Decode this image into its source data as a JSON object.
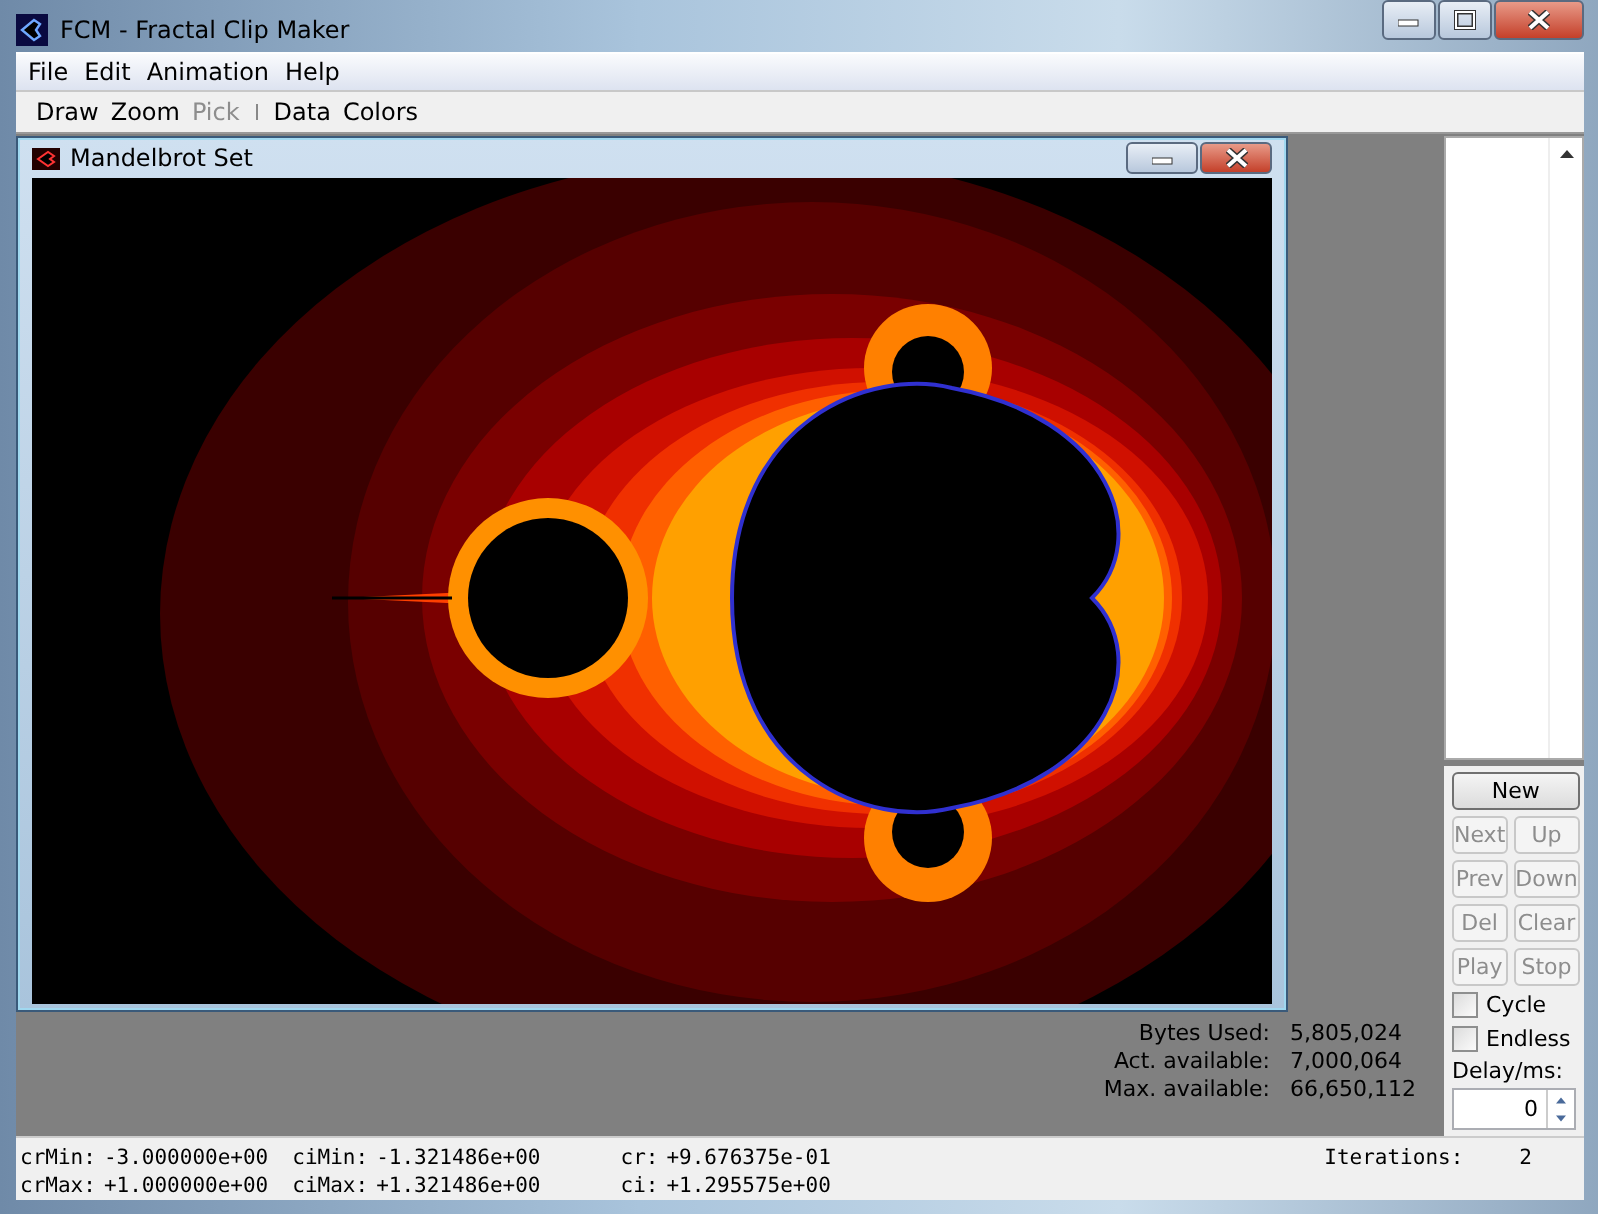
{
  "window": {
    "title": "FCM - Fractal Clip Maker"
  },
  "menu": [
    "File",
    "Edit",
    "Animation",
    "Help"
  ],
  "toolbar": [
    [
      {
        "label": "Draw",
        "disabled": false
      },
      {
        "label": "Zoom",
        "disabled": false
      },
      {
        "label": "Pick",
        "disabled": true
      }
    ],
    [
      {
        "label": "Data",
        "disabled": false
      },
      {
        "label": "Colors",
        "disabled": false
      }
    ]
  ],
  "child_window": {
    "title": "Mandelbrot Set"
  },
  "memory": [
    {
      "label": "Bytes Used:",
      "value": "5,805,024"
    },
    {
      "label": "Act. available:",
      "value": "7,000,064"
    },
    {
      "label": "Max. available:",
      "value": "66,650,112"
    }
  ],
  "controls": {
    "buttons": [
      {
        "label": "New",
        "disabled": false
      },
      {
        "label": "Next",
        "disabled": true
      },
      {
        "label": "Up",
        "disabled": true
      },
      {
        "label": "Prev",
        "disabled": true
      },
      {
        "label": "Down",
        "disabled": true
      },
      {
        "label": "Del",
        "disabled": true
      },
      {
        "label": "Clear",
        "disabled": true
      },
      {
        "label": "Play",
        "disabled": true
      },
      {
        "label": "Stop",
        "disabled": true
      }
    ],
    "checkboxes": [
      {
        "label": "Cycle",
        "checked": false
      },
      {
        "label": "Endless",
        "checked": false
      }
    ],
    "delay": {
      "label": "Delay/ms:",
      "value": "0"
    }
  },
  "status": {
    "columns": [
      [
        {
          "label": "crMin:",
          "value": "-3.000000e+00"
        },
        {
          "label": "crMax:",
          "value": "+1.000000e+00"
        }
      ],
      [
        {
          "label": "ciMin:",
          "value": "-1.321486e+00"
        },
        {
          "label": "ciMax:",
          "value": "+1.321486e+00"
        }
      ],
      [
        {
          "label": "cr:",
          "value": "+9.676375e-01"
        },
        {
          "label": "ci:",
          "value": "+1.295575e+00"
        }
      ]
    ],
    "iterations": {
      "label": "Iterations:",
      "value": "2"
    }
  }
}
